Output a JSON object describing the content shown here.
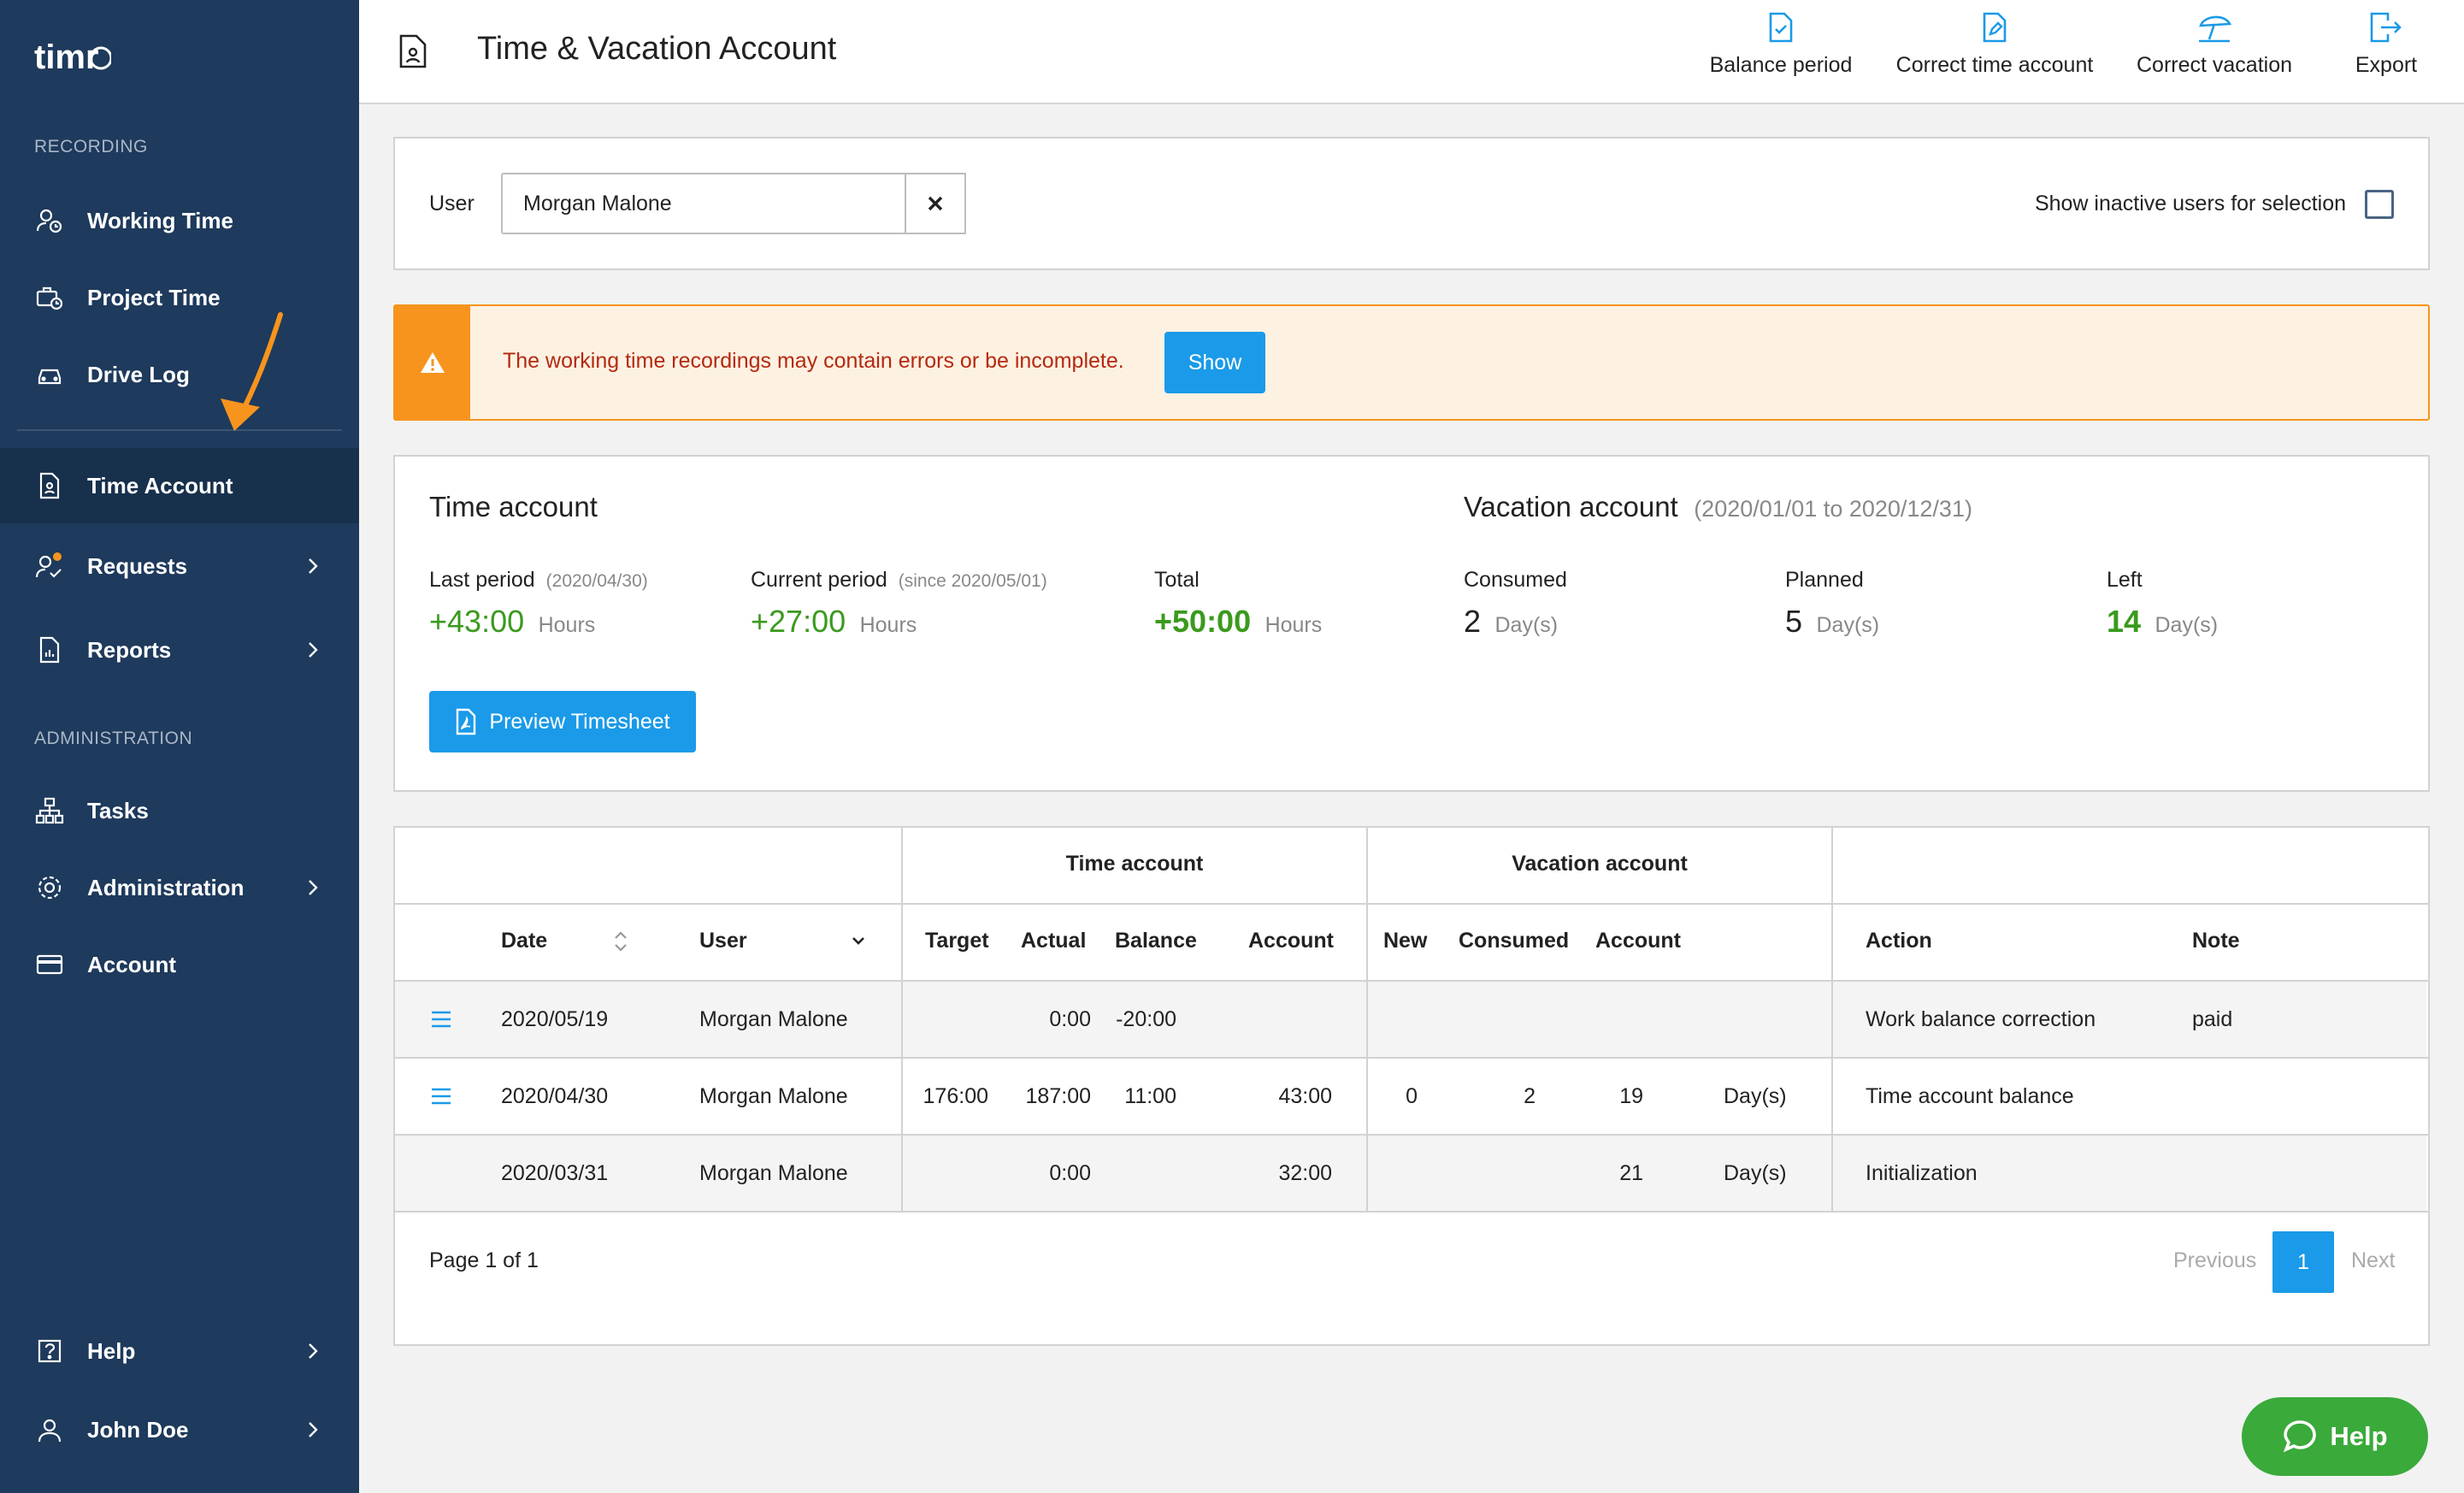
{
  "app": {
    "logo_text": "timr"
  },
  "sidebar": {
    "recording_label": "RECORDING",
    "administration_label": "ADMINISTRATION",
    "items": [
      {
        "label": "Working Time",
        "icon": "user-clock-icon"
      },
      {
        "label": "Project Time",
        "icon": "briefcase-clock-icon"
      },
      {
        "label": "Drive Log",
        "icon": "car-icon"
      },
      {
        "label": "Time Account",
        "icon": "document-icon"
      },
      {
        "label": "Requests",
        "icon": "user-check-icon"
      },
      {
        "label": "Reports",
        "icon": "report-icon"
      },
      {
        "label": "Tasks",
        "icon": "hierarchy-icon"
      },
      {
        "label": "Administration",
        "icon": "gear-icon"
      },
      {
        "label": "Account",
        "icon": "credit-card-icon"
      },
      {
        "label": "Help",
        "icon": "question-icon"
      },
      {
        "label": "John Doe",
        "icon": "user-icon"
      }
    ]
  },
  "header": {
    "title": "Time & Vacation Account",
    "actions": [
      {
        "label": "Balance period"
      },
      {
        "label": "Correct time account"
      },
      {
        "label": "Correct vacation"
      },
      {
        "label": "Export"
      }
    ]
  },
  "filter": {
    "user_label": "User",
    "user_value": "Morgan Malone",
    "inactive_label": "Show inactive users for selection",
    "inactive_checked": false
  },
  "alert": {
    "message": "The working time recordings may contain errors or be incomplete.",
    "button": "Show"
  },
  "summary": {
    "time_title": "Time account",
    "vacation_title": "Vacation account",
    "vacation_range": "(2020/01/01 to 2020/12/31)",
    "last_period_label": "Last period",
    "last_period_date": "(2020/04/30)",
    "last_period_value": "+43:00",
    "current_period_label": "Current period",
    "current_period_date": "(since 2020/05/01)",
    "current_period_value": "+27:00",
    "total_label": "Total",
    "total_value": "+50:00",
    "hours_unit": "Hours",
    "consumed_label": "Consumed",
    "consumed_value": "2",
    "planned_label": "Planned",
    "planned_value": "5",
    "left_label": "Left",
    "left_value": "14",
    "days_unit": "Day(s)",
    "preview_button": "Preview Timesheet"
  },
  "table": {
    "group_time": "Time account",
    "group_vacation": "Vacation account",
    "columns": {
      "date": "Date",
      "user": "User",
      "target": "Target",
      "actual": "Actual",
      "balance": "Balance",
      "account": "Account",
      "new": "New",
      "consumed": "Consumed",
      "vac_account": "Account",
      "action": "Action",
      "note": "Note"
    },
    "rows": [
      {
        "date": "2020/05/19",
        "user": "Morgan Malone",
        "target": "",
        "actual": "0:00",
        "balance": "-20:00",
        "account": "",
        "new": "",
        "consumed": "",
        "vac_account": "",
        "unit": "",
        "action": "Work balance correction",
        "note": "paid"
      },
      {
        "date": "2020/04/30",
        "user": "Morgan Malone",
        "target": "176:00",
        "actual": "187:00",
        "balance": "11:00",
        "account": "43:00",
        "new": "0",
        "consumed": "2",
        "vac_account": "19",
        "unit": "Day(s)",
        "action": "Time account balance",
        "note": ""
      },
      {
        "date": "2020/03/31",
        "user": "Morgan Malone",
        "target": "",
        "actual": "0:00",
        "balance": "",
        "account": "32:00",
        "new": "",
        "consumed": "",
        "vac_account": "21",
        "unit": "Day(s)",
        "action": "Initialization",
        "note": ""
      }
    ],
    "page_info": "Page 1 of 1",
    "previous": "Previous",
    "current_page": "1",
    "next": "Next"
  },
  "help_button": "Help",
  "colors": {
    "sidebar": "#1e3a5c",
    "accent": "#1a9ae8",
    "warning": "#f7941d",
    "green": "#3a9a1e",
    "help": "#3aaa3a"
  }
}
